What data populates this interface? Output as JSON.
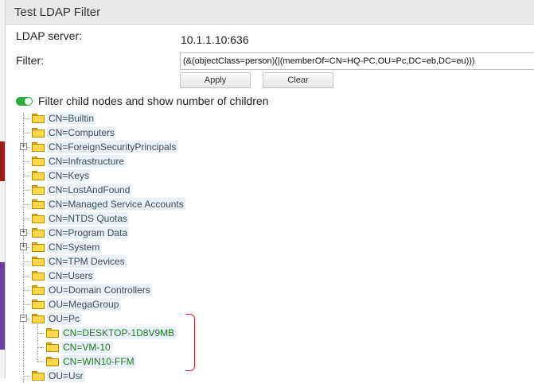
{
  "window": {
    "title": "Test LDAP Filter"
  },
  "server": {
    "label": "LDAP server:",
    "value": "10.1.1.10:636"
  },
  "filter": {
    "label": "Filter:",
    "value": "(&(objectClass=person)(|(memberOf=CN=HQ-PC,OU=Pc,DC=eb,DC=eu)))"
  },
  "buttons": {
    "apply": "Apply",
    "clear": "Clear"
  },
  "toggle": {
    "label": "Filter child nodes and show number of children",
    "on": true
  },
  "tree": [
    {
      "label": "CN=Builtin",
      "expandable": false
    },
    {
      "label": "CN=Computers",
      "expandable": false
    },
    {
      "label": "CN=ForeignSecurityPrincipals",
      "expandable": true
    },
    {
      "label": "CN=Infrastructure",
      "expandable": false
    },
    {
      "label": "CN=Keys",
      "expandable": false
    },
    {
      "label": "CN=LostAndFound",
      "expandable": false
    },
    {
      "label": "CN=Managed Service Accounts",
      "expandable": false
    },
    {
      "label": "CN=NTDS Quotas",
      "expandable": false
    },
    {
      "label": "CN=Program Data",
      "expandable": true
    },
    {
      "label": "CN=System",
      "expandable": true
    },
    {
      "label": "CN=TPM Devices",
      "expandable": false
    },
    {
      "label": "CN=Users",
      "expandable": false
    },
    {
      "label": "OU=Domain Controllers",
      "expandable": false
    },
    {
      "label": "OU=MegaGroup",
      "expandable": false
    },
    {
      "label": "OU=Pc",
      "expandable": true,
      "expanded": true,
      "children": [
        {
          "label": "CN=DESKTOP-1D8V9MB"
        },
        {
          "label": "CN=VM-10"
        },
        {
          "label": "CN=WIN10-FFM"
        }
      ]
    },
    {
      "label": "OU=Usr",
      "expandable": false
    }
  ],
  "colors": {
    "accent_green": "#2eaa3c",
    "match_text": "#1d7a1d",
    "highlight_bracket": "#d21f2f"
  }
}
